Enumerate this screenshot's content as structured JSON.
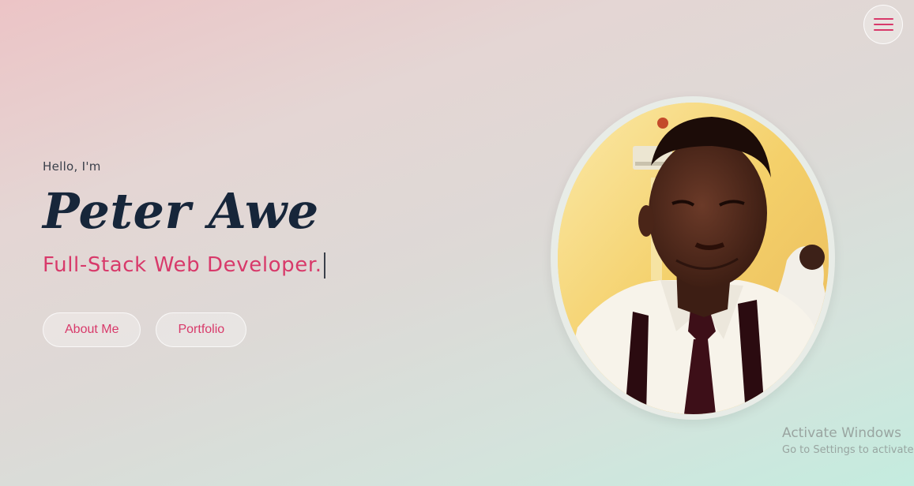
{
  "nav": {
    "menu_icon": "hamburger-menu-icon"
  },
  "hero": {
    "greeting": "Hello, I'm",
    "name": "Peter Awe",
    "role": "Full-Stack Web Developer."
  },
  "buttons": {
    "about_label": "About Me",
    "portfolio_label": "Portfolio"
  },
  "profile": {
    "photo": "profile-photo"
  },
  "watermark": {
    "title": "Activate Windows",
    "subtitle": "Go to Settings to activate"
  },
  "colors": {
    "accent": "#d8396a",
    "name_text": "#17263a",
    "body_text": "#3a3f4a"
  }
}
